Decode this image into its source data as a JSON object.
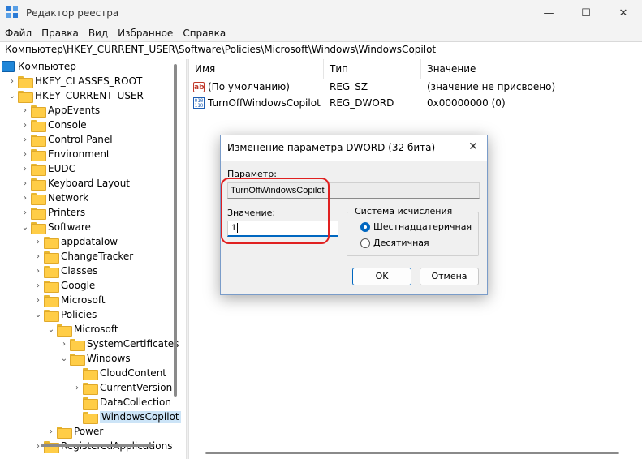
{
  "window": {
    "title": "Редактор реестра",
    "minimize": "—",
    "maximize": "☐",
    "close": "✕"
  },
  "menu": [
    "Файл",
    "Правка",
    "Вид",
    "Избранное",
    "Справка"
  ],
  "address": "Компьютер\\HKEY_CURRENT_USER\\Software\\Policies\\Microsoft\\Windows\\WindowsCopilot",
  "tree": [
    {
      "label": "Компьютер",
      "chev": "",
      "icon": "pc"
    },
    {
      "label": "HKEY_CLASSES_ROOT",
      "chev": ">",
      "icon": "folder"
    },
    {
      "label": "HKEY_CURRENT_USER",
      "chev": "v",
      "icon": "folder"
    },
    {
      "label": "AppEvents",
      "chev": ">",
      "icon": "folder"
    },
    {
      "label": "Console",
      "chev": ">",
      "icon": "folder"
    },
    {
      "label": "Control Panel",
      "chev": ">",
      "icon": "folder"
    },
    {
      "label": "Environment",
      "chev": ">",
      "icon": "folder"
    },
    {
      "label": "EUDC",
      "chev": ">",
      "icon": "folder"
    },
    {
      "label": "Keyboard Layout",
      "chev": ">",
      "icon": "folder"
    },
    {
      "label": "Network",
      "chev": ">",
      "icon": "folder"
    },
    {
      "label": "Printers",
      "chev": ">",
      "icon": "folder"
    },
    {
      "label": "Software",
      "chev": "v",
      "icon": "folder"
    },
    {
      "label": "appdatalow",
      "chev": ">",
      "icon": "folder"
    },
    {
      "label": "ChangeTracker",
      "chev": ">",
      "icon": "folder"
    },
    {
      "label": "Classes",
      "chev": ">",
      "icon": "folder"
    },
    {
      "label": "Google",
      "chev": ">",
      "icon": "folder"
    },
    {
      "label": "Microsoft",
      "chev": ">",
      "icon": "folder"
    },
    {
      "label": "Policies",
      "chev": "v",
      "icon": "folder"
    },
    {
      "label": "Microsoft",
      "chev": "v",
      "icon": "folder"
    },
    {
      "label": "SystemCertificates",
      "chev": ">",
      "icon": "folder"
    },
    {
      "label": "Windows",
      "chev": "v",
      "icon": "folder"
    },
    {
      "label": "CloudContent",
      "chev": "",
      "icon": "folder"
    },
    {
      "label": "CurrentVersion",
      "chev": ">",
      "icon": "folder"
    },
    {
      "label": "DataCollection",
      "chev": "",
      "icon": "folder"
    },
    {
      "label": "WindowsCopilot",
      "chev": "",
      "icon": "folder",
      "selected": true
    },
    {
      "label": "Power",
      "chev": ">",
      "icon": "folder"
    },
    {
      "label": "RegisteredApplications",
      "chev": ">",
      "icon": "folder"
    }
  ],
  "list": {
    "headers": [
      "Имя",
      "Тип",
      "Значение"
    ],
    "rows": [
      {
        "name": "(По умолчанию)",
        "type": "REG_SZ",
        "value": "(значение не присвоено)",
        "icon": "ab-icon"
      },
      {
        "name": "TurnOffWindowsCopilot",
        "type": "REG_DWORD",
        "value": "0x00000000 (0)",
        "icon": "binary-icon"
      }
    ]
  },
  "dialog": {
    "title": "Изменение параметра DWORD (32 бита)",
    "close": "✕",
    "param_label": "Параметр:",
    "param_value": "TurnOffWindowsCopilot",
    "value_label": "Значение:",
    "value": "1",
    "base_group": "Система исчисления",
    "radio_hex": "Шестнадцатеричная",
    "radio_dec": "Десятичная",
    "selected_base": "hex",
    "ok": "OK",
    "cancel": "Отмена"
  },
  "colors": {
    "accent": "#0067c0",
    "highlight": "#e02020",
    "folder": "#ffcd47",
    "selection": "#cce4f7"
  }
}
